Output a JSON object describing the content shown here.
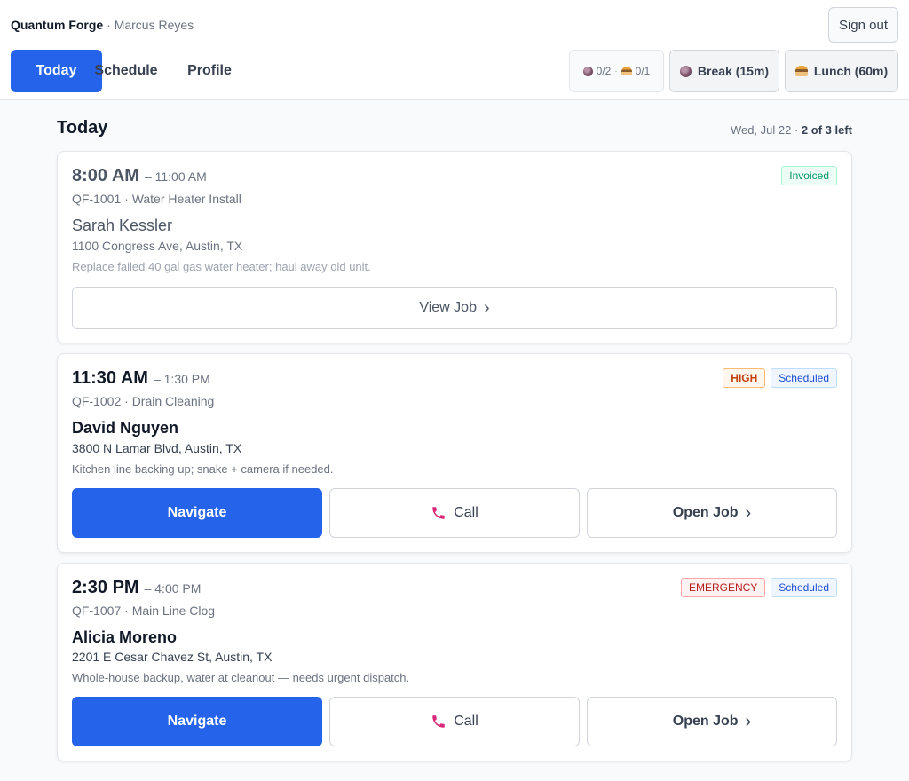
{
  "app": {
    "company": "Quantum Forge",
    "separator": " · ",
    "user": "Marcus Reyes",
    "sign_out": "Sign out"
  },
  "tabs": [
    {
      "label": "Today",
      "active": true
    },
    {
      "label": "Schedule",
      "active": false
    },
    {
      "label": "Profile",
      "active": false
    }
  ],
  "breaks": {
    "donut_count": "0/2",
    "burger_count": "0/1",
    "break_label": "Break (15m)",
    "lunch_label": "Lunch (60m)"
  },
  "page": {
    "title": "Today",
    "date": "Wed, Jul 22",
    "remaining": "2 of 3 left"
  },
  "colors": {
    "primary": "#2563eb",
    "call_icon": "#db2777"
  },
  "jobs": [
    {
      "start": "8:00 AM",
      "end": "– 11:00 AM",
      "meta": "QF-1001 · Water Heater Install",
      "customer": "Sarah Kessler",
      "address": "1100 Congress Ave, Austin, TX",
      "note": "Replace failed 40 gal gas water heater; haul away old unit.",
      "badges": [
        "Invoiced"
      ],
      "action": "View Job"
    },
    {
      "start": "11:30 AM",
      "end": "– 1:30 PM",
      "meta": "QF-1002 · Drain Cleaning",
      "customer": "David Nguyen",
      "address": "3800 N Lamar Blvd, Austin, TX",
      "note": "Kitchen line backing up; snake + camera if needed.",
      "badges": [
        "HIGH",
        "Scheduled"
      ],
      "navigate": "Navigate",
      "call": "Call",
      "open": "Open Job"
    },
    {
      "start": "2:30 PM",
      "end": "– 4:00 PM",
      "meta": "QF-1007 · Main Line Clog",
      "customer": "Alicia Moreno",
      "address": "2201 E Cesar Chavez St, Austin, TX",
      "note": "Whole-house backup, water at cleanout — needs urgent dispatch.",
      "badges": [
        "EMERGENCY",
        "Scheduled"
      ],
      "navigate": "Navigate",
      "call": "Call",
      "open": "Open Job"
    }
  ]
}
